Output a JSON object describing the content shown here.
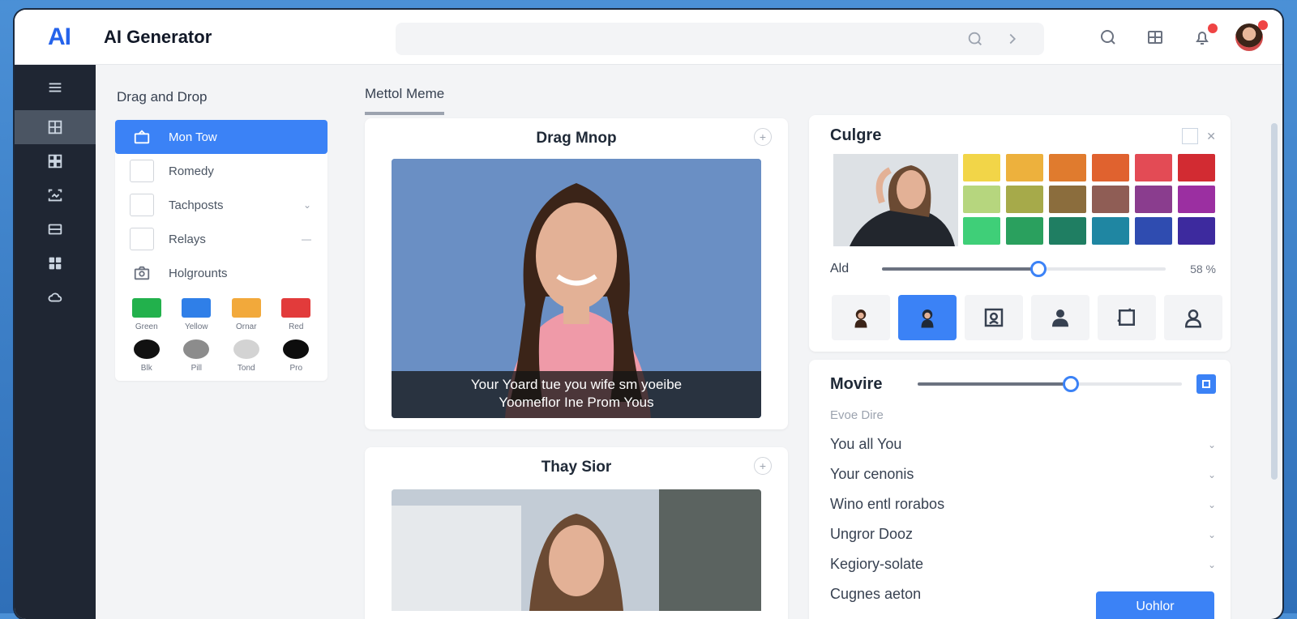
{
  "app": {
    "logo": "AI",
    "title": "AI Generator"
  },
  "left_panel": {
    "title": "Drag and Drop",
    "items": [
      {
        "label": "Mon Tow",
        "type": "active"
      },
      {
        "label": "Romedy",
        "type": "check"
      },
      {
        "label": "Tachposts",
        "type": "check",
        "has_chevron": true
      },
      {
        "label": "Relays",
        "type": "check",
        "has_chevron": true
      },
      {
        "label": "Holgrounts",
        "type": "icon"
      }
    ],
    "swatches": [
      {
        "label": "Green",
        "color": "#22b14c"
      },
      {
        "label": "Yellow",
        "color": "#2f7fe8"
      },
      {
        "label": "Ornar",
        "color": "#f2a93b"
      },
      {
        "label": "Red",
        "color": "#e23b3b"
      }
    ],
    "dots": [
      {
        "label": "Blk",
        "color": "#111111"
      },
      {
        "label": "Pill",
        "color": "#8c8c8c"
      },
      {
        "label": "Tond",
        "color": "#d3d3d3"
      },
      {
        "label": "Pro",
        "color": "#0d0d0d"
      }
    ]
  },
  "center": {
    "tab_label": "Mettol Meme",
    "card1": {
      "title": "Drag Mnop",
      "caption_line1": "Your Yoard tue you wife sm yoeibe",
      "caption_line2": "Yoomeflor Ine Prom Yous"
    },
    "card2": {
      "title": "Thay Sior"
    }
  },
  "color_panel": {
    "title": "Culgre",
    "colors": [
      "#f2d548",
      "#edb13d",
      "#e07b2e",
      "#e0622f",
      "#e34b55",
      "#d22b32",
      "#b6d67e",
      "#a6aa4a",
      "#8b6d3d",
      "#8f5d55",
      "#8a3d8e",
      "#9b2fa1",
      "#3fcf78",
      "#2aa05e",
      "#1f7e62",
      "#1f86a2",
      "#2f4cb0",
      "#3d2a9e"
    ],
    "slider": {
      "label": "Ald",
      "value_text": "58 %",
      "value": 0.55
    }
  },
  "movie_panel": {
    "title": "Movire",
    "slider_value": 0.58,
    "subtitle": "Evoe Dire",
    "rows": [
      "You all You",
      "Your cenonis",
      "Wino entl rorabos",
      "Ungror Dooz",
      "Kegiory-solate",
      "Cugnes aeton"
    ],
    "button_label": "Uohlor"
  }
}
